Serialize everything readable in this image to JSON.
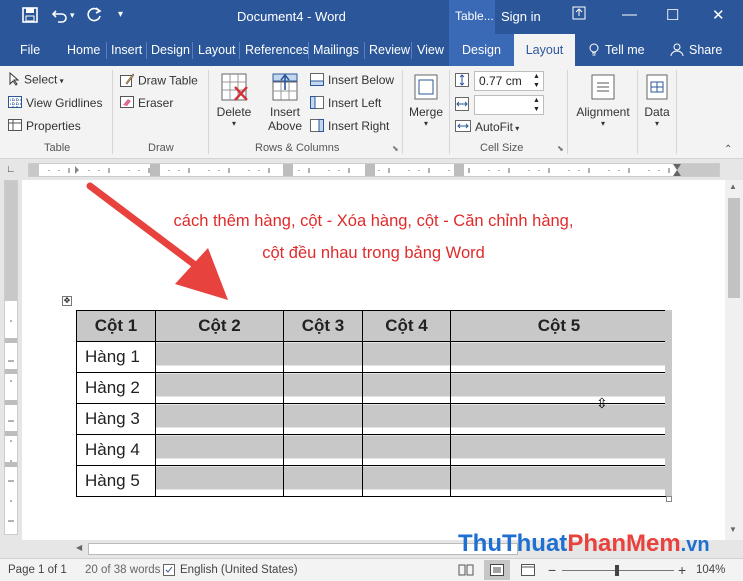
{
  "window": {
    "title": "Document4 - Word",
    "context_tab": "Table...",
    "sign_in": "Sign in"
  },
  "tabs": [
    "File",
    "Home",
    "Insert",
    "Design",
    "Layout",
    "References",
    "Mailings",
    "Review",
    "View",
    "Design",
    "Layout"
  ],
  "tell_me": "Tell me",
  "share": "Share",
  "ribbon": {
    "table": {
      "select": "Select",
      "view_gridlines": "View Gridlines",
      "properties": "Properties",
      "label": "Table"
    },
    "draw": {
      "draw_table": "Draw Table",
      "eraser": "Eraser",
      "label": "Draw"
    },
    "rows_columns": {
      "delete": "Delete",
      "insert": "Insert",
      "above": "Above",
      "insert_below": "Insert Below",
      "insert_left": "Insert Left",
      "insert_right": "Insert Right",
      "label": "Rows & Columns"
    },
    "merge": {
      "label": "Merge"
    },
    "cell_size": {
      "height_value": "0.77 cm",
      "width_value": "",
      "autofit": "AutoFit",
      "label": "Cell Size"
    },
    "alignment": {
      "label": "Alignment"
    },
    "data": {
      "label": "Data"
    }
  },
  "document": {
    "caption_line1": "cách thêm hàng, cột - Xóa hàng, cột - Căn chỉnh hàng,",
    "caption_line2": "cột đều nhau trong bảng Word",
    "table": {
      "headers": [
        "Cột 1",
        "Cột 2",
        "Cột 3",
        "Cột 4",
        "Cột 5"
      ],
      "rows": [
        "Hàng 1",
        "Hàng 2",
        "Hàng 3",
        "Hàng 4",
        "Hàng 5"
      ]
    }
  },
  "status": {
    "page": "Page 1 of 1",
    "words": "20 of 38 words",
    "language": "English (United States)",
    "zoom": "104%"
  },
  "watermark": {
    "part1": "ThuThuat",
    "part2": "PhanMem",
    "part3": ".vn"
  },
  "colors": {
    "accent": "#2b579a",
    "caption": "#e02b2b",
    "arrow": "#e8423f"
  }
}
